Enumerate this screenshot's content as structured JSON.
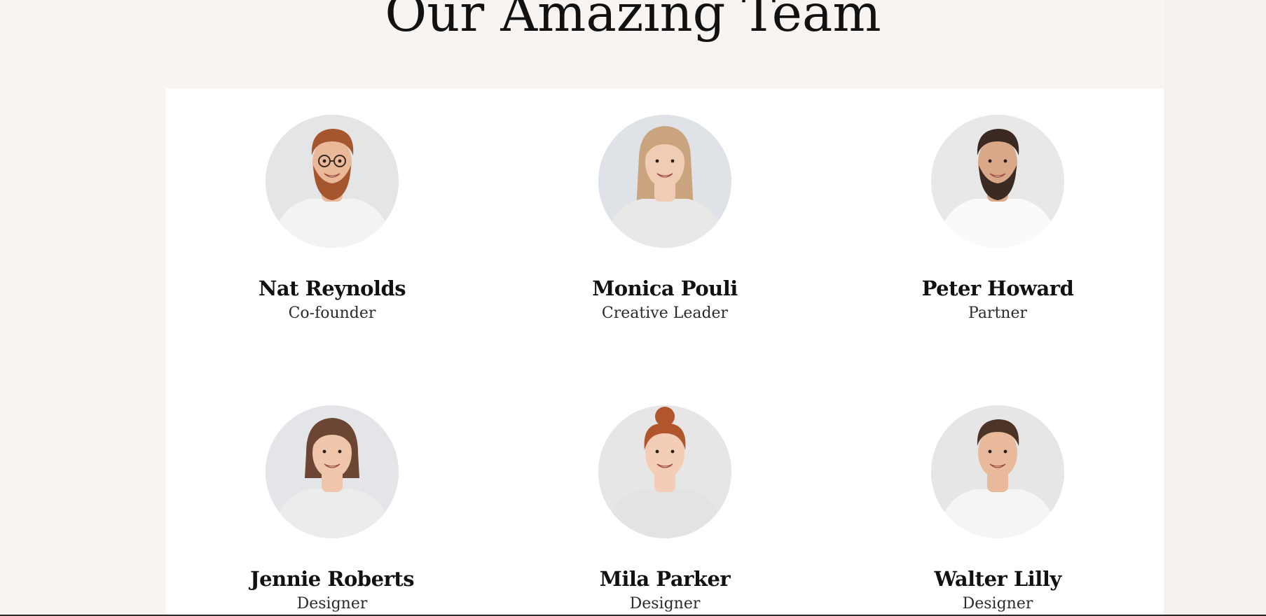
{
  "section": {
    "title": "Our Amazing Team"
  },
  "team": {
    "members": [
      {
        "name": "Nat Reynolds",
        "role": "Co-founder",
        "avatar": {
          "bg": "#e4e5e7",
          "skin": "#e9b999",
          "hair": "#a5562f",
          "shirt": "#f4f3f1",
          "beard": true,
          "glasses": true,
          "hair_style": "short"
        }
      },
      {
        "name": "Monica Pouli",
        "role": "Creative Leader",
        "avatar": {
          "bg": "#dfe2e6",
          "skin": "#f0ccb4",
          "hair": "#c9a47e",
          "shirt": "#e9e8e6",
          "beard": false,
          "glasses": false,
          "hair_style": "long"
        }
      },
      {
        "name": "Peter Howard",
        "role": "Partner",
        "avatar": {
          "bg": "#e8e8e8",
          "skin": "#d9a888",
          "hair": "#3b2a22",
          "shirt": "#fafafa",
          "beard": true,
          "glasses": false,
          "hair_style": "short"
        }
      },
      {
        "name": "Jennie Roberts",
        "role": "Designer",
        "avatar": {
          "bg": "#e3e5e8",
          "skin": "#efc6ab",
          "hair": "#6b4633",
          "shirt": "#ececec",
          "beard": false,
          "glasses": false,
          "hair_style": "bob"
        }
      },
      {
        "name": "Mila Parker",
        "role": "Designer",
        "avatar": {
          "bg": "#e6e6e6",
          "skin": "#f3cdb5",
          "hair": "#b0552c",
          "shirt": "#e3e3e2",
          "beard": false,
          "glasses": false,
          "hair_style": "bun"
        }
      },
      {
        "name": "Walter Lilly",
        "role": "Designer",
        "avatar": {
          "bg": "#e6e6e6",
          "skin": "#e8b99b",
          "hair": "#4b3326",
          "shirt": "#f5f5f5",
          "beard": false,
          "glasses": false,
          "hair_style": "short"
        }
      }
    ]
  }
}
